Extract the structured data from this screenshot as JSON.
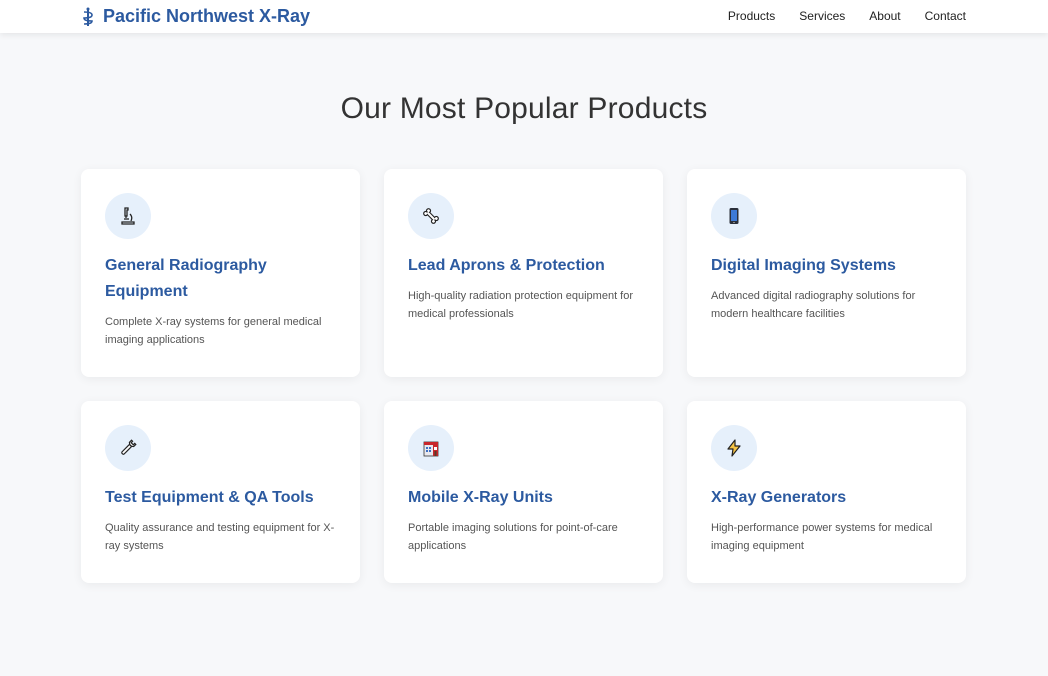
{
  "nav": {
    "brand": "Pacific Northwest X-Ray",
    "links": [
      "Products",
      "Services",
      "About",
      "Contact"
    ]
  },
  "main": {
    "title": "Our Most Popular Products",
    "products": [
      {
        "icon": "microscope-icon",
        "title": "General Radiography Equipment",
        "description": "Complete X-ray systems for general medical imaging applications"
      },
      {
        "icon": "bone-icon",
        "title": "Lead Aprons & Protection",
        "description": "High-quality radiation protection equipment for medical professionals"
      },
      {
        "icon": "mobile-phone-icon",
        "title": "Digital Imaging Systems",
        "description": "Advanced digital radiography solutions for modern healthcare facilities"
      },
      {
        "icon": "wrench-icon",
        "title": "Test Equipment & QA Tools",
        "description": "Quality assurance and testing equipment for X-ray systems"
      },
      {
        "icon": "hospital-icon",
        "title": "Mobile X-Ray Units",
        "description": "Portable imaging solutions for point-of-care applications"
      },
      {
        "icon": "lightning-icon",
        "title": "X-Ray Generators",
        "description": "High-performance power systems for medical imaging equipment"
      }
    ]
  },
  "colors": {
    "accent": "#2c5aa0",
    "icon_bg": "#e6f0fb",
    "page_bg": "#f7f8fa"
  }
}
